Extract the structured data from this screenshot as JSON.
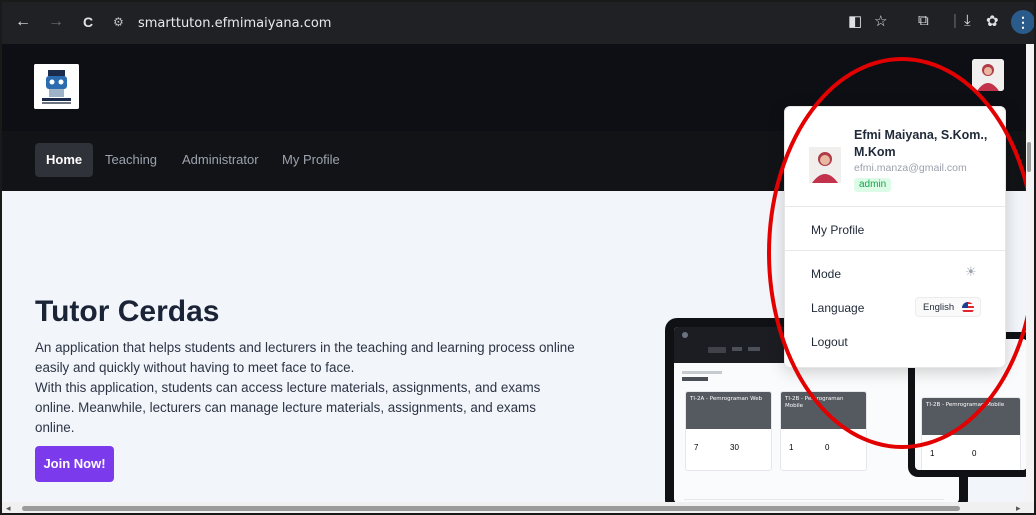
{
  "browser": {
    "url": "smarttuton.efmimaiyana.com",
    "back_icon": "←",
    "forward_icon": "→",
    "reload_icon": "C",
    "site_info_icon": "⚙",
    "star_icon": "☆",
    "extension_icon": "⧉",
    "download_icon": "⤓",
    "menu_icon": "⋮"
  },
  "nav": {
    "items": [
      {
        "label": "Home",
        "active": true
      },
      {
        "label": "Teaching"
      },
      {
        "label": "Administrator"
      },
      {
        "label": "My Profile"
      }
    ]
  },
  "hero": {
    "title": "Tutor Cerdas",
    "paragraph_1": "An application that helps students and lecturers in the teaching and learning process online easily and quickly without having to meet face to face.",
    "paragraph_2": "With this application, students can access lecture materials, assignments, and exams online. Meanwhile, lecturers can manage lecture materials, assignments, and exams online.",
    "cta_label": "Join Now!"
  },
  "mockup": {
    "card_1_title": "TI-2A - Pemrograman Web",
    "card_2_title": "TI-2B - Pemrograman Mobile",
    "tablet_card_title": "TI-2B - Pemrograman Mobile",
    "card_1_stats": [
      "7",
      "30"
    ],
    "card_2_stats": [
      "1",
      "0"
    ],
    "tablet_stats": [
      "1",
      "0"
    ]
  },
  "profile_menu": {
    "name": "Efmi Maiyana, S.Kom., M.Kom",
    "email": "efmi.manza@gmail.com",
    "role": "admin",
    "my_profile_label": "My Profile",
    "mode_label": "Mode",
    "mode_icon": "☀",
    "language_label": "Language",
    "language_value": "English",
    "logout_label": "Logout"
  },
  "colors": {
    "accent": "#7c3aed",
    "annotation": "#e30000",
    "admin_badge": "#16a34a"
  }
}
